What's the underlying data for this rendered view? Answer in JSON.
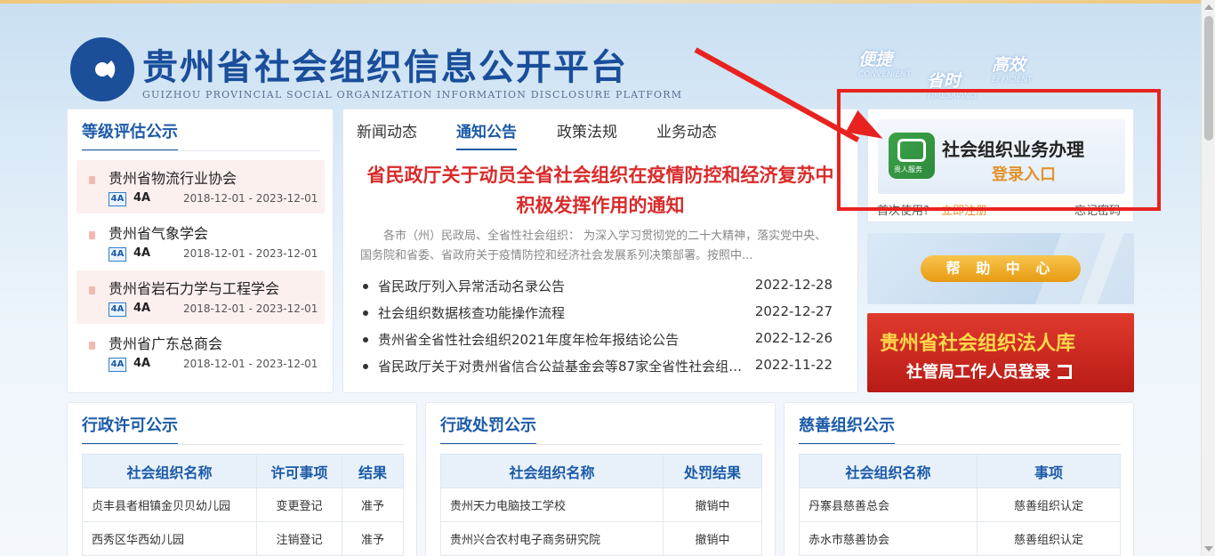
{
  "header": {
    "title": "贵州省社会组织信息公开平台",
    "subtitle": "GUIZHOU PROVINCIAL SOCIAL ORGANIZATION INFORMATION DISCLOSURE PLATFORM",
    "slogans": [
      {
        "zh": "便捷",
        "en": "CONVENIENT"
      },
      {
        "zh": "省时",
        "en": "TIMESAVING"
      },
      {
        "zh": "高效",
        "en": "EFFICIENT"
      }
    ]
  },
  "grade": {
    "title": "等级评估公示",
    "items": [
      {
        "name": "贵州省物流行业协会",
        "badge": "4A",
        "level": "4A",
        "date": "2018-12-01 - 2023-12-01"
      },
      {
        "name": "贵州省气象学会",
        "badge": "4A",
        "level": "4A",
        "date": "2018-12-01 - 2023-12-01"
      },
      {
        "name": "贵州省岩石力学与工程学会",
        "badge": "4A",
        "level": "4A",
        "date": "2018-12-01 - 2023-12-01"
      },
      {
        "name": "贵州省广东总商会",
        "badge": "4A",
        "level": "4A",
        "date": "2018-12-01 - 2023-12-01"
      }
    ]
  },
  "news": {
    "tabs": [
      "新闻动态",
      "通知公告",
      "政策法规",
      "业务动态"
    ],
    "active_tab": "通知公告",
    "headline": "省民政厅关于动员全省社会组织在疫情防控和经济复苏中积极发挥作用的通知",
    "summary": "各市（州）民政局、全省性社会组织： 为深入学习贯彻党的二十大精神，落实党中央、国务院和省委、省政府关于疫情防控和经济社会发展系列决策部署。按照中...",
    "items": [
      {
        "title": "省民政厅列入异常活动名录公告",
        "date": "2022-12-28"
      },
      {
        "title": "社会组织数据核查功能操作流程",
        "date": "2022-12-27"
      },
      {
        "title": "贵州省全省性社会组织2021年度年检年报结论公告",
        "date": "2022-12-26"
      },
      {
        "title": "省民政厅关于对贵州省信合公益基金会等87家全省性社会组织的公告",
        "date": "2022-11-22"
      }
    ]
  },
  "business": {
    "title": "社会组织业务办理",
    "login": "登录入口",
    "icon_caption": "贵人服务",
    "first_use": "首次使用?",
    "register": "立即注册",
    "forgot": "忘记密码"
  },
  "help": {
    "label": "帮 助 中 心"
  },
  "law": {
    "title": "贵州省社会组织法人库",
    "sub": "社管局工作人员登录"
  },
  "permit": {
    "title": "行政许可公示",
    "headers": [
      "社会组织名称",
      "许可事项",
      "结果"
    ],
    "rows": [
      [
        "贞丰县者相镇金贝贝幼儿园",
        "变更登记",
        "准予"
      ],
      [
        "西秀区华西幼儿园",
        "注销登记",
        "准予"
      ]
    ]
  },
  "penalty": {
    "title": "行政处罚公示",
    "headers": [
      "社会组织名称",
      "处罚结果"
    ],
    "rows": [
      [
        "贵州天力电脑技工学校",
        "撤销中"
      ],
      [
        "贵州兴合农村电子商务研究院",
        "撤销中"
      ]
    ]
  },
  "charity": {
    "title": "慈善组织公示",
    "headers": [
      "社会组织名称",
      "事项"
    ],
    "rows": [
      [
        "丹寨县慈善总会",
        "慈善组织认定"
      ],
      [
        "赤水市慈善协会",
        "慈善组织认定"
      ]
    ]
  },
  "colors": {
    "brand": "#1b5aa8",
    "headline": "#d92b2b",
    "highlight_frame": "#e8231f",
    "accent_orange": "#e3922b"
  }
}
